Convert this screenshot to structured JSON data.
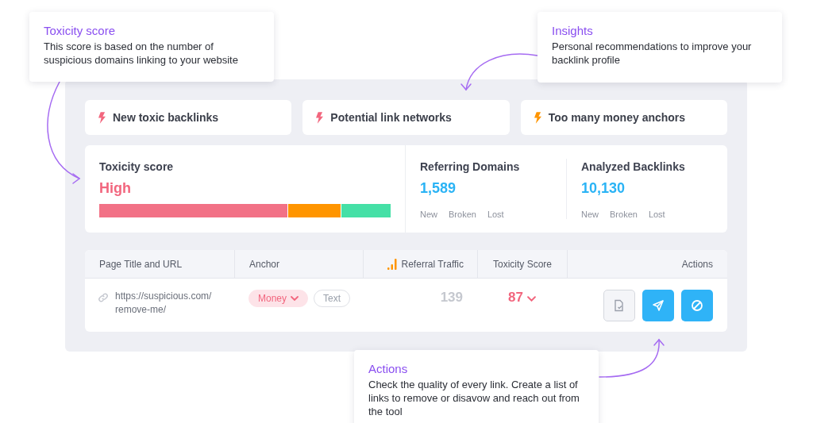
{
  "callouts": [
    {
      "title": "Toxicity score",
      "text": "This score is based on the number of suspicious domains linking to your website"
    },
    {
      "title": "Insights",
      "text": "Personal recommendations to improve your backlink profile"
    },
    {
      "title": "Actions",
      "text": "Check the quality of every link. Create a list of links to remove or disavow and reach out from the tool"
    }
  ],
  "alerts": [
    {
      "label": "New toxic backlinks",
      "color": "#f2667e"
    },
    {
      "label": "Potential link networks",
      "color": "#f2667e"
    },
    {
      "label": "Too many money anchors",
      "color": "#ff9500"
    }
  ],
  "toxicity": {
    "label": "Toxicity score",
    "value": "High",
    "segments": [
      {
        "color": "#f27186"
      },
      {
        "color": "#ff9500"
      },
      {
        "color": "#45e0a6"
      }
    ]
  },
  "stats": [
    {
      "label": "Referring Domains",
      "value": "1,589",
      "links": [
        "New",
        "Broken",
        "Lost"
      ]
    },
    {
      "label": "Analyzed Backlinks",
      "value": "10,130",
      "links": [
        "New",
        "Broken",
        "Lost"
      ]
    }
  ],
  "table": {
    "columns": [
      "Page Title and URL",
      "Anchor",
      "Referral Traffic",
      "Toxicity Score",
      "Actions"
    ],
    "rows": [
      {
        "url": "https://suspicious.com/ remove-me/",
        "anchors": [
          {
            "label": "Money",
            "selected": true
          },
          {
            "label": "Text",
            "selected": false
          }
        ],
        "traffic": "139",
        "score": "87"
      }
    ]
  }
}
